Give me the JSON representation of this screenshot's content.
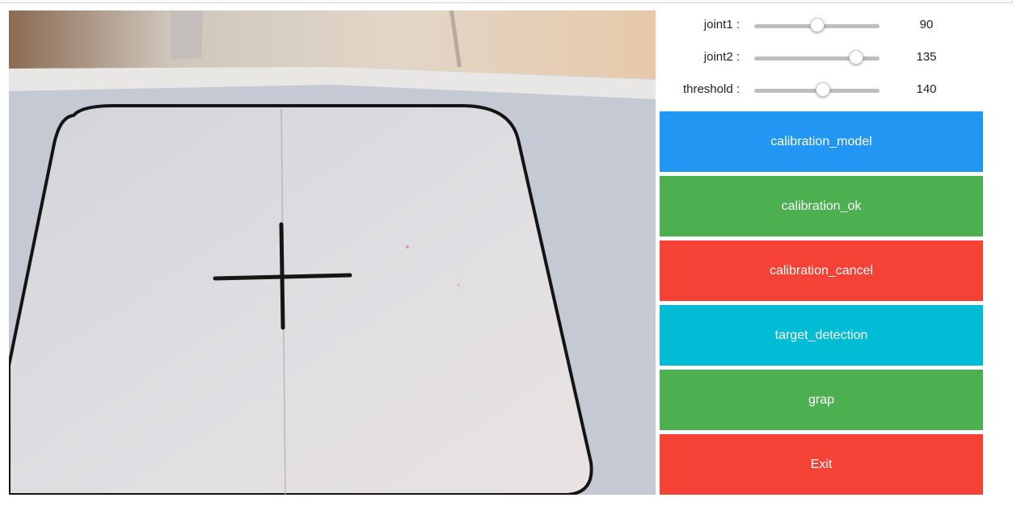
{
  "sliders": [
    {
      "label": "joint1 :",
      "value": "90",
      "level": 0.5
    },
    {
      "label": "joint2 :",
      "value": "135",
      "level": 0.81
    },
    {
      "label": "threshold :",
      "value": "140",
      "level": 0.55
    }
  ],
  "buttons": [
    {
      "label": "calibration_model",
      "color": "#2196f3"
    },
    {
      "label": "calibration_ok",
      "color": "#4caf50"
    },
    {
      "label": "calibration_cancel",
      "color": "#f44336"
    },
    {
      "label": "target_detection",
      "color": "#00bcd4"
    },
    {
      "label": "grap",
      "color": "#4caf50"
    },
    {
      "label": "Exit",
      "color": "#f44336"
    }
  ]
}
